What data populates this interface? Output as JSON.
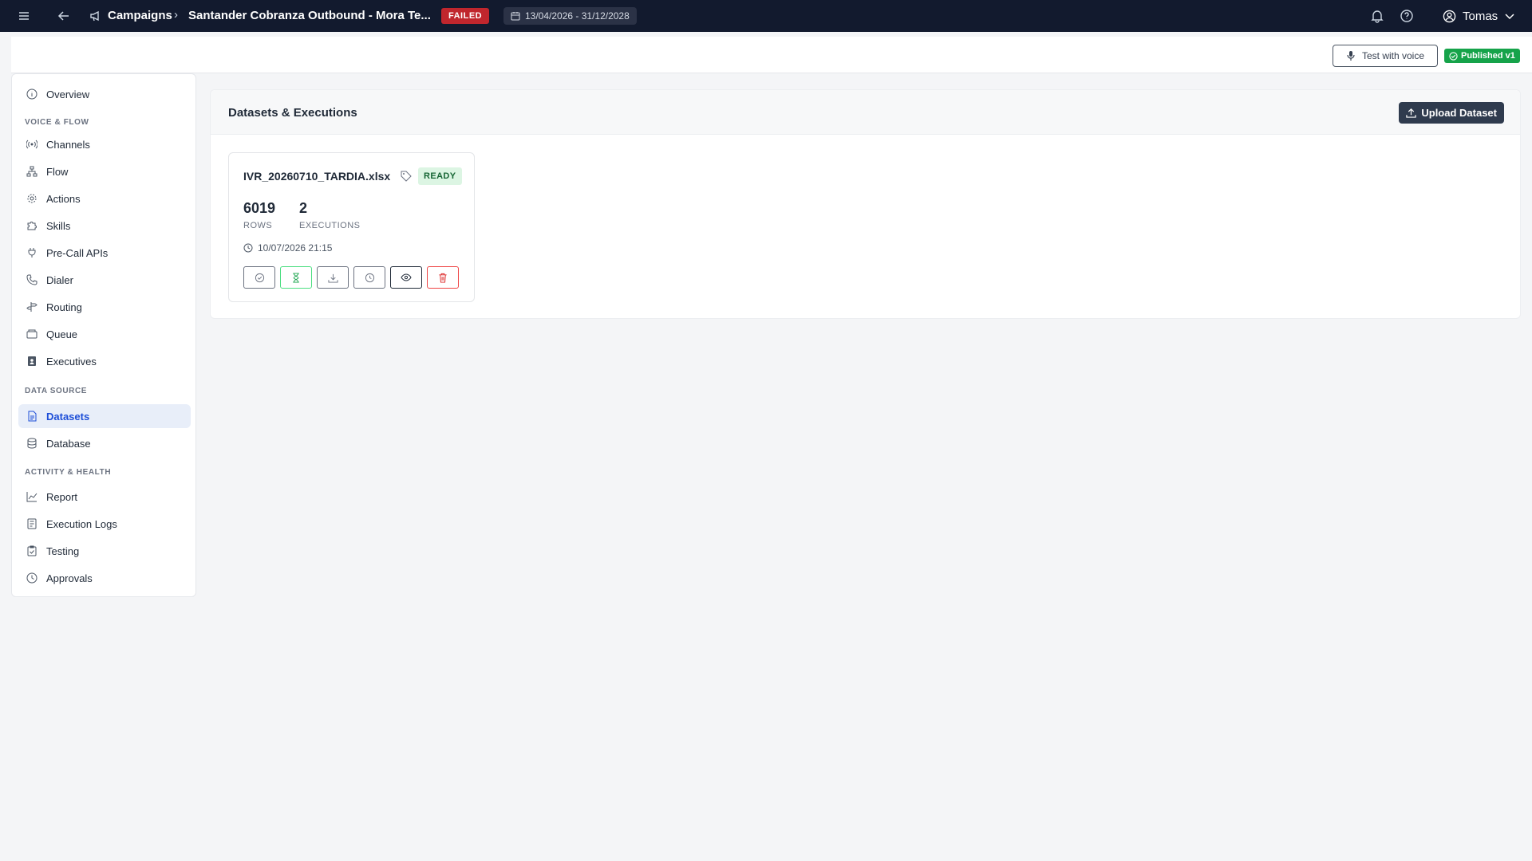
{
  "topbar": {
    "breadcrumb_parent": "Campaigns",
    "breadcrumb_separator": "›",
    "campaign_name": "Santander Cobranza Outbound - Mora Te...",
    "status": "FAILED",
    "date_range": "13/04/2026 - 31/12/2028",
    "user_name": "Tomas"
  },
  "subheader": {
    "test_voice_label": "Test with voice",
    "published_label": "Published v1"
  },
  "sidebar": {
    "overview": "Overview",
    "section_voice_flow": "VOICE & FLOW",
    "channels": "Channels",
    "flow": "Flow",
    "actions": "Actions",
    "skills": "Skills",
    "precall_apis": "Pre-Call APIs",
    "dialer": "Dialer",
    "routing": "Routing",
    "queue": "Queue",
    "executives": "Executives",
    "section_data_source": "DATA SOURCE",
    "datasets": "Datasets",
    "database": "Database",
    "section_activity_health": "ACTIVITY & HEALTH",
    "report": "Report",
    "execution_logs": "Execution Logs",
    "testing": "Testing",
    "approvals": "Approvals"
  },
  "panel": {
    "title": "Datasets & Executions",
    "upload_label": "Upload Dataset"
  },
  "dataset_card": {
    "filename": "IVR_20260710_TARDIA.xlsx",
    "status": "READY",
    "rows_value": "6019",
    "rows_label": "ROWS",
    "executions_value": "2",
    "executions_label": "EXECUTIONS",
    "timestamp": "10/07/2026 21:15"
  },
  "colors": {
    "topbar_bg": "#121a2e",
    "failed_badge": "#c0262d",
    "published_badge": "#16a34a",
    "active_nav_bg": "#e8eef9",
    "active_nav_text": "#1d4ed8",
    "ready_badge_bg": "#dcf5e3",
    "upload_button_bg": "#2f3b4e"
  }
}
